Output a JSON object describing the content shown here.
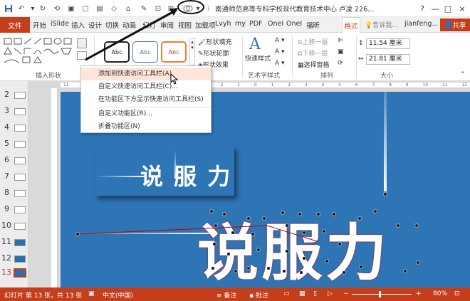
{
  "window": {
    "title": "南通师范高等专科学校现代教育技术中心  卢凌 226...",
    "buttons": [
      "?",
      "—",
      "□",
      "×"
    ]
  },
  "quick_access": {
    "icons": [
      "save-icon",
      "undo-icon",
      "redo-icon",
      "repeat-icon",
      "format-painter-icon",
      "new-icon",
      "open-icon",
      "shape-icon",
      "pin-icon",
      "present-icon",
      "merge-shapes-icon",
      "customize-dropdown-icon"
    ]
  },
  "tabs": {
    "file": "文件",
    "items": [
      "开始",
      "iSlide",
      "插入",
      "设计",
      "切换",
      "动画",
      "幻灯",
      "审阅",
      "视图",
      "加载项",
      "Lvyh",
      "my",
      "PDF",
      "OneI",
      "OneI",
      "福昕",
      "格式"
    ],
    "active": "格式",
    "tell_me": "告诉我...",
    "user": "jianfeng...",
    "share": "共享"
  },
  "ribbon": {
    "groups": {
      "insert_shapes": "插入形状",
      "art_style": "艺术字样式",
      "arrange": "排列",
      "size": "大小"
    },
    "style_sample": "Abc",
    "shape_fill": "形状填充",
    "shape_outline": "形状轮廓",
    "shape_effects": "形状效果",
    "quick_styles": "快速样式",
    "bring_forward": "上移一层",
    "send_backward": "下移一层",
    "selection_pane": "选择窗格",
    "height": "11.54 厘米",
    "width": "21.81 厘米"
  },
  "context_menu": {
    "items": [
      "添加到快速访问工具栏(A)",
      "自定义快速访问工具栏(C)...",
      "在功能区下方显示快速访问工具栏(S)",
      "自定义功能区(R)...",
      "折叠功能区(N)"
    ],
    "hover_index": 0
  },
  "slides": {
    "numbers": [
      "2",
      "3",
      "4",
      "5",
      "6",
      "7",
      "8",
      "9",
      "10",
      "11",
      "12",
      "13"
    ],
    "selected": "13"
  },
  "slide_content": {
    "small_text": "说 服 力",
    "big_text": "说服力"
  },
  "ruler": {
    "ticks": [
      "11",
      "10",
      "9",
      "8",
      "7",
      "6",
      "5",
      "4",
      "3",
      "2",
      "1",
      "0",
      "1",
      "2",
      "3",
      "4",
      "5",
      "6",
      "7",
      "8",
      "9",
      "10",
      "11",
      "12"
    ]
  },
  "statusbar": {
    "slide_info": "幻灯片 第 13 张，共 13 张",
    "language": "中文(中国)",
    "notes": "备注",
    "comments": "批注",
    "zoom": "80%"
  },
  "colors": {
    "accent": "#c43e1c",
    "slide_bg": "#2e75b6",
    "menu_hover": "#fde6d9"
  }
}
